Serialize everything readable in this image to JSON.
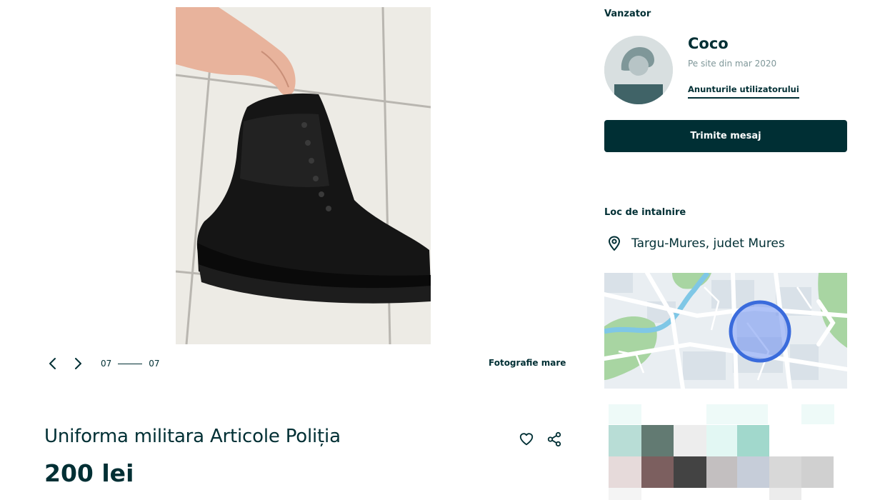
{
  "gallery": {
    "current": "07",
    "total": "07",
    "big_photo_label": "Fotografie mare"
  },
  "listing": {
    "title": "Uniforma militara Articole Poliția",
    "price": "200 lei"
  },
  "seller": {
    "section_label": "Vanzator",
    "name": "Coco",
    "member_since": "Pe site din mar 2020",
    "ads_link": "Anunturile utilizatorului",
    "message_button": "Trimite mesaj"
  },
  "location": {
    "section_label": "Loc de intalnire",
    "city": "Targu-Mures, judet Mures"
  },
  "icons": {
    "prev": "chevron-left-icon",
    "next": "chevron-right-icon",
    "favorite": "heart-icon",
    "share": "share-icon",
    "pin": "location-pin-icon"
  },
  "colors": {
    "brand_dark": "#002f34",
    "muted_text": "#7f9799",
    "map_circle": "#3a6bdc"
  }
}
